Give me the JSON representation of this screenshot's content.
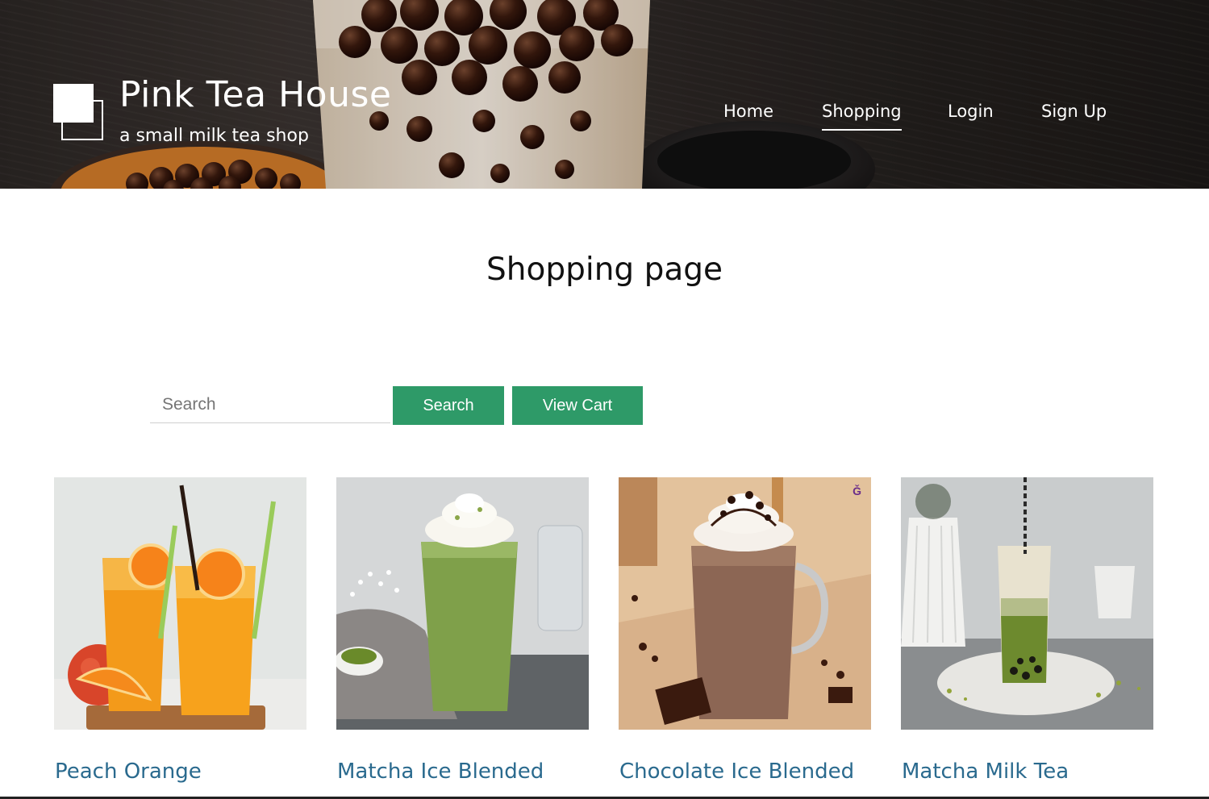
{
  "brand": {
    "title": "Pink Tea House",
    "subtitle": "a small milk tea shop"
  },
  "nav": [
    {
      "label": "Home",
      "active": false
    },
    {
      "label": "Shopping",
      "active": true
    },
    {
      "label": "Login",
      "active": false
    },
    {
      "label": "Sign Up",
      "active": false
    }
  ],
  "page": {
    "title": "Shopping page"
  },
  "search": {
    "placeholder": "Search",
    "value": "",
    "button_label": "Search"
  },
  "cart": {
    "button_label": "View Cart"
  },
  "products": [
    {
      "name": "Peach Orange"
    },
    {
      "name": "Matcha Ice Blended"
    },
    {
      "name": "Chocolate Ice Blended"
    },
    {
      "name": "Matcha Milk Tea"
    }
  ],
  "colors": {
    "button": "#2e9a68",
    "product_name": "#2a6a8e",
    "nav_text": "#ffffff"
  }
}
